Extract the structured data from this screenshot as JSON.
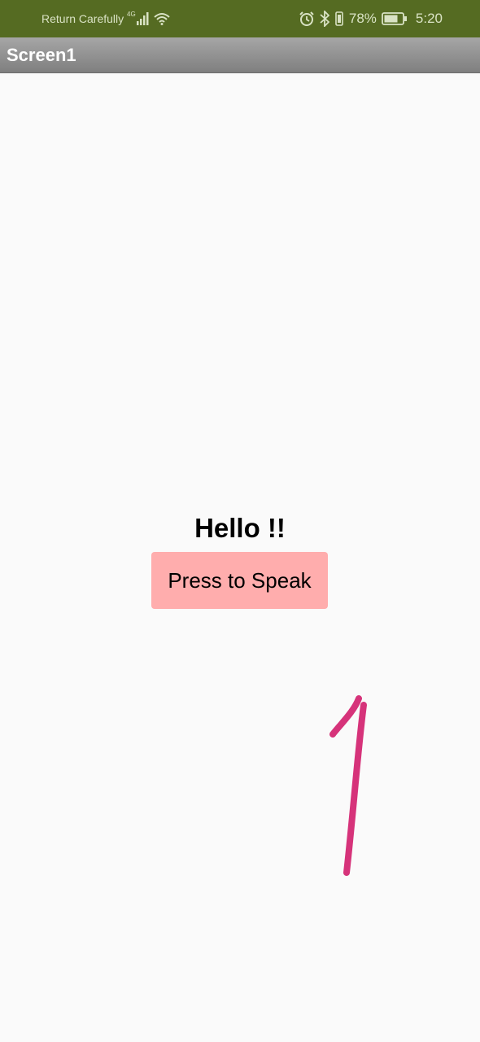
{
  "status_bar": {
    "carrier": "Return Carefully",
    "network_type": "4G",
    "battery_percent": "78%",
    "time": "5:20",
    "background_color": "#556b22",
    "icons": [
      "signal-icon",
      "wifi-icon",
      "alarm-icon",
      "bluetooth-icon",
      "vibrate-icon",
      "battery-icon"
    ]
  },
  "app_bar": {
    "title": "Screen1"
  },
  "main": {
    "greeting": "Hello !!",
    "speak_button_label": "Press to Speak",
    "button_color": "#ffadad"
  },
  "annotation": {
    "text": "1",
    "color": "#d6337a"
  }
}
